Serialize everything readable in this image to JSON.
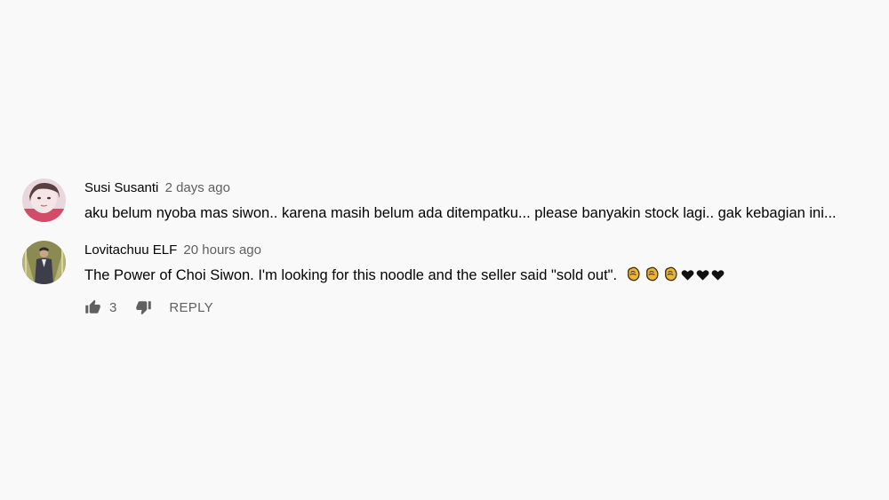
{
  "comments": [
    {
      "author": "Susi Susanti",
      "time": "2 days ago",
      "text": "aku belum nyoba mas siwon.. karena masih belum ada ditempatku... please banyakin stock lagi.. gak kebagian ini..."
    },
    {
      "author": "Lovitachuu ELF",
      "time": "20 hours ago",
      "text": "The Power of Choi Siwon. I'm looking for this noodle and the seller said \"sold out\".",
      "emojis": [
        "clapping-hands",
        "clapping-hands",
        "clapping-hands",
        "black-heart",
        "black-heart",
        "black-heart"
      ],
      "actions": {
        "like_count": "3",
        "reply_label": "REPLY"
      }
    }
  ],
  "colors": {
    "background": "#f9f9f9",
    "text": "#030303",
    "secondary": "#606060",
    "clap": "#e9b532"
  }
}
